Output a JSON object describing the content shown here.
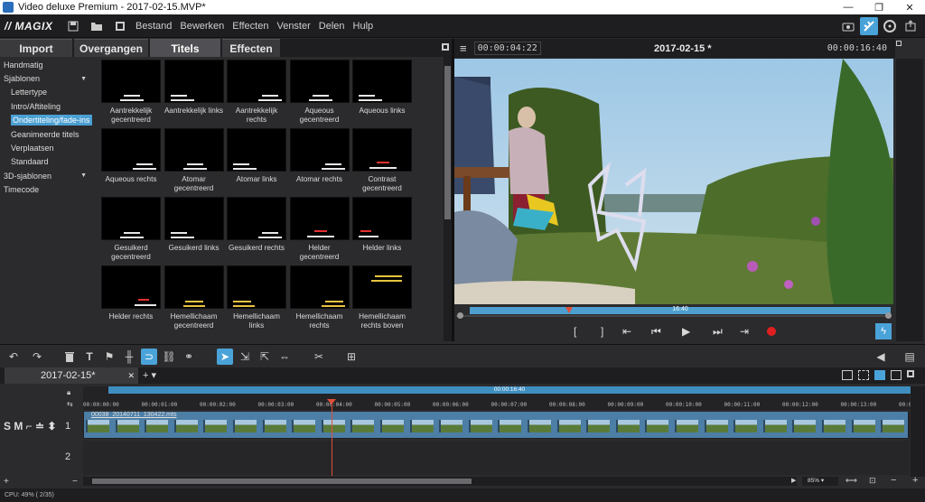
{
  "window": {
    "title": "Video deluxe Premium - 2017-02-15.MVP*",
    "controls": [
      "—",
      "❐",
      "✕"
    ]
  },
  "menubar": {
    "logo": "// MAGIX",
    "items": [
      "Bestand",
      "Bewerken",
      "Effecten",
      "Venster",
      "Delen",
      "Hulp"
    ]
  },
  "tabs": [
    "Import",
    "Overgangen",
    "Titels",
    "Effecten"
  ],
  "active_tab": "Titels",
  "tree": [
    {
      "label": "Handmatig",
      "level": 0
    },
    {
      "label": "Sjablonen",
      "level": 0,
      "expander": "▼"
    },
    {
      "label": "Lettertype",
      "level": 1
    },
    {
      "label": "Intro/Aftiteling",
      "level": 1
    },
    {
      "label": "Ondertiteling/fade-ins",
      "level": 1,
      "selected": true
    },
    {
      "label": "Geanimeerde titels",
      "level": 1
    },
    {
      "label": "Verplaatsen",
      "level": 1
    },
    {
      "label": "Standaard",
      "level": 1
    },
    {
      "label": "3D-sjablonen",
      "level": 0,
      "expander": "▼"
    },
    {
      "label": "Timecode",
      "level": 0
    }
  ],
  "title_templates": [
    {
      "label": "Aantrekkelijk gecentreerd",
      "style": "center"
    },
    {
      "label": "Aantrekkelijk links",
      "style": "left"
    },
    {
      "label": "Aantrekkelijk rechts",
      "style": "right"
    },
    {
      "label": "Aqueous gecentreerd",
      "style": "center"
    },
    {
      "label": "Aqueous links",
      "style": "left"
    },
    {
      "label": "Aqueous rechts",
      "style": "right"
    },
    {
      "label": "Atomar gecentreerd",
      "style": "center"
    },
    {
      "label": "Atomar links",
      "style": "left"
    },
    {
      "label": "Atomar rechts",
      "style": "right"
    },
    {
      "label": "Contrast gecentreerd",
      "style": "center-red"
    },
    {
      "label": "Gesuikerd gecentreerd",
      "style": "center"
    },
    {
      "label": "Gesuikerd links",
      "style": "left"
    },
    {
      "label": "Gesuikerd rechts",
      "style": "right"
    },
    {
      "label": "Helder gecentreerd",
      "style": "center-red"
    },
    {
      "label": "Helder links",
      "style": "left-red"
    },
    {
      "label": "Helder rechts",
      "style": "right-red"
    },
    {
      "label": "Hemellichaam gecentreerd",
      "style": "center-yellow"
    },
    {
      "label": "Hemellichaam links",
      "style": "left-yellow"
    },
    {
      "label": "Hemellichaam rechts",
      "style": "right-yellow"
    },
    {
      "label": "Hemellichaam rechts boven",
      "style": "top-yellow"
    }
  ],
  "preview": {
    "timecode_left": "00:00:04:22",
    "title": "2017-02-15 *",
    "timecode_right": "00:00:16:40",
    "bar_label": "16:40",
    "controls": [
      "[",
      "]",
      "⇤",
      "⏮",
      "▶",
      "⏭",
      "⇥"
    ]
  },
  "project": {
    "tab_label": "2017-02-15*",
    "close": "✕",
    "add": "+ ▾"
  },
  "timeline": {
    "duration_label": "00:00:16:40",
    "ticks": [
      "00:00:00:00",
      "00:00:01:00",
      "00:00:02:00",
      "00:00:03:00",
      "00:00:04:00",
      "00:00:05:00",
      "00:00:06:00",
      "00:00:07:00",
      "00:00:08:00",
      "00:00:09:00",
      "00:00:10:00",
      "00:00:11:00",
      "00:00:12:00",
      "00:00:13:00",
      "00:00:14:00"
    ],
    "clip_name": "00038_20140711_130422.mts",
    "track1_label": "1",
    "track2_label": "2",
    "track_head_label": "S M ⌐ ≐ ⬍",
    "zoom": "85%"
  },
  "status": "CPU: 49% ( 2/35)",
  "colors": {
    "accent": "#4aa3d8",
    "clip": "#4c7ea6",
    "playhead": "#e0503a",
    "record": "#e02020"
  }
}
